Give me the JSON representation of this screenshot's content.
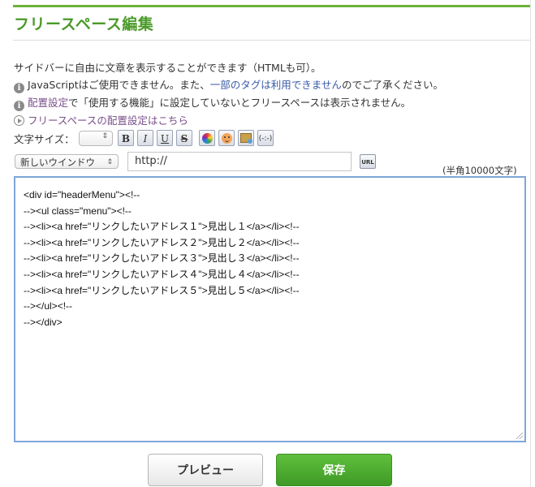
{
  "page": {
    "title": "フリースペース編集"
  },
  "notices": {
    "intro": "サイドバーに自由に文章を表示することができます（HTMLも可）。",
    "js_pre": "JavaScriptはご使用できません。また、",
    "js_link": "一部のタグは利用できません",
    "js_post": "のでご了承ください。",
    "layout_link": "配置設定",
    "layout_post": "で「使用する機能」に設定していないとフリースペースは表示されません。",
    "layout_settings_link": "フリースペースの配置設定はこちら"
  },
  "toolbar": {
    "font_size_label": "文字サイズ：",
    "font_size_value": "",
    "bold": "B",
    "italic": "I",
    "underline": "U",
    "strike": "S",
    "emoticon": "(-:-)",
    "icons": [
      "color-picker-icon",
      "emoji-icon",
      "image-icon",
      "emoticon-icon"
    ]
  },
  "link_row": {
    "window_option": "新しいウインドウ",
    "url_value": "http://",
    "url_button": "URL",
    "char_limit": "(半角10000文字)"
  },
  "editor": {
    "lines": [
      "<div id=\"headerMenu\"><!--",
      "--><ul class=\"menu\"><!--",
      "--><li><a href=\"リンクしたいアドレス１\">見出し１</a></li><!--",
      "--><li><a href=\"リンクしたいアドレス２\">見出し２</a></li><!--",
      "--><li><a href=\"リンクしたいアドレス３\">見出し３</a></li><!--",
      "--><li><a href=\"リンクしたいアドレス４\">見出し４</a></li><!--",
      "--><li><a href=\"リンクしたいアドレス５\">見出し５</a></li><!--",
      "--></ul><!--",
      "--></div>"
    ]
  },
  "actions": {
    "preview": "プレビュー",
    "save": "保存"
  },
  "colors": {
    "accent": "#4a9a29",
    "save_button": "#4aa52e",
    "link": "#7a4f8a",
    "editor_border": "#7fa6d8"
  }
}
